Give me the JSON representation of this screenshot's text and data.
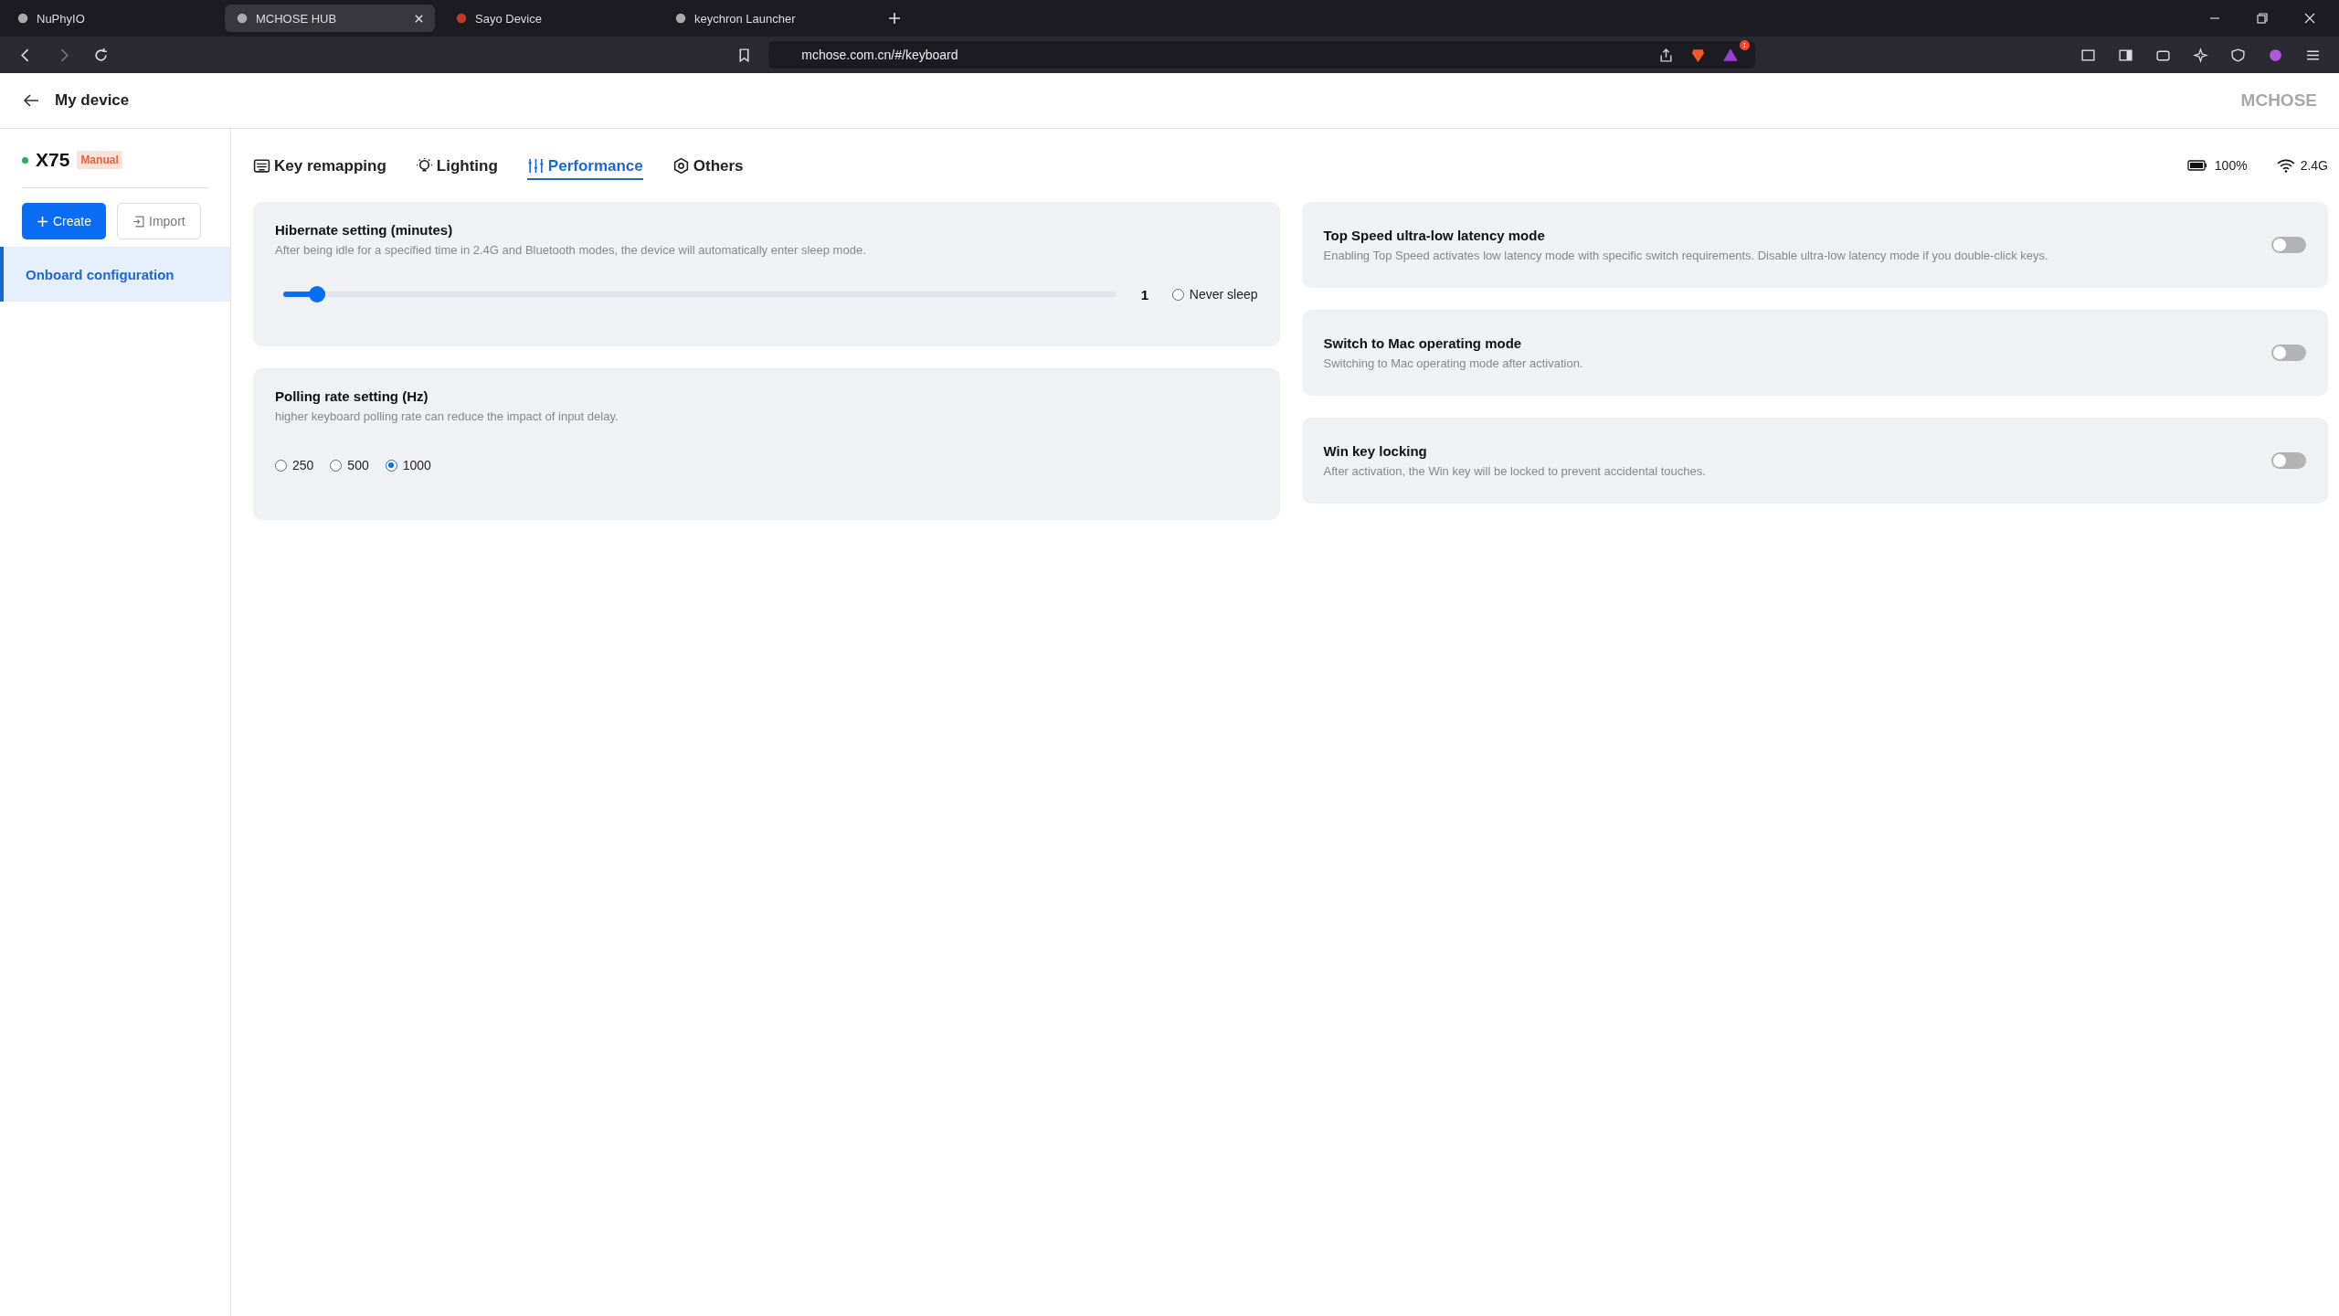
{
  "browser": {
    "tabs": [
      {
        "title": "NuPhyIO",
        "selected": false
      },
      {
        "title": "MCHOSE HUB",
        "selected": true
      },
      {
        "title": "Sayo Device",
        "selected": false
      },
      {
        "title": "keychron Launcher",
        "selected": false
      }
    ],
    "url": "mchose.com.cn/#/keyboard",
    "alert_count": "1"
  },
  "header": {
    "title": "My device",
    "brand": "MCHOSE"
  },
  "device": {
    "name": "X75",
    "connected": true,
    "badge": "Manual"
  },
  "actions": {
    "create": "Create",
    "import": "Import"
  },
  "sidebar": {
    "items": [
      {
        "label": "Onboard configuration",
        "selected": true
      }
    ]
  },
  "tabs": [
    {
      "label": "Key remapping",
      "selected": false
    },
    {
      "label": "Lighting",
      "selected": false
    },
    {
      "label": "Performance",
      "selected": true
    },
    {
      "label": "Others",
      "selected": false
    }
  ],
  "status": {
    "battery": "100%",
    "connection": "2.4G"
  },
  "hibernate": {
    "title": "Hibernate setting (minutes)",
    "description": "After being idle for a specified time in 2.4G and Bluetooth modes, the device will automatically enter sleep mode.",
    "level": 0.05,
    "value": "1",
    "never_sleep": {
      "label": "Never sleep",
      "checked": false
    }
  },
  "polling": {
    "title": "Polling rate setting (Hz)",
    "description": "higher keyboard polling rate can reduce the impact of input delay.",
    "options": [
      {
        "label": "250",
        "selected": false
      },
      {
        "label": "500",
        "selected": false
      },
      {
        "label": "1000",
        "selected": true
      }
    ]
  },
  "toggles": [
    {
      "title": "Top Speed ultra-low latency mode",
      "description": "Enabling Top Speed activates low latency mode with specific switch requirements. Disable ultra-low latency mode if you double-click keys.",
      "on": false
    },
    {
      "title": "Switch to Mac operating mode",
      "description": "Switching to Mac operating mode after activation.",
      "on": false
    },
    {
      "title": "Win key locking",
      "description": "After activation, the Win key will be locked to prevent accidental touches.",
      "on": false
    }
  ]
}
